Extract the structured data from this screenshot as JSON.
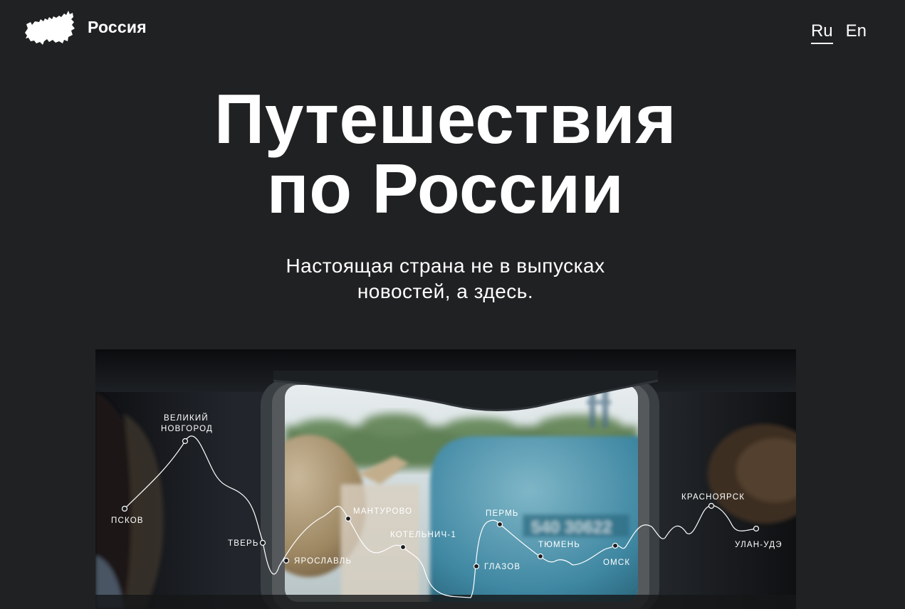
{
  "header": {
    "logo_icon": "russia-map-icon",
    "logo_text": "Россия",
    "languages": [
      {
        "label": "Ru",
        "active": true
      },
      {
        "label": "En",
        "active": false
      }
    ]
  },
  "hero": {
    "title_line1": "Путешествия",
    "title_line2": "по России",
    "subtitle_line1": "Настоящая страна не в выпусках",
    "subtitle_line2": "новостей, а здесь."
  },
  "route": {
    "stations": [
      {
        "name": "ПСКОВ"
      },
      {
        "name_line1": "ВЕЛИКИЙ",
        "name_line2": "НОВГОРОД"
      },
      {
        "name": "ТВЕРЬ"
      },
      {
        "name": "ЯРОСЛАВЛЬ"
      },
      {
        "name": "МАНТУРОВО"
      },
      {
        "name": "КОТЕЛЬНИЧ-1"
      },
      {
        "name": "ГЛАЗОВ"
      },
      {
        "name": "ПЕРМЬ"
      },
      {
        "name": "ТЮМЕНЬ"
      },
      {
        "name": "ОМСК"
      },
      {
        "name": "КРАСНОЯРСК"
      },
      {
        "name": "УЛАН-УДЭ"
      }
    ]
  },
  "colors": {
    "background": "#202122",
    "text": "#ffffff"
  }
}
